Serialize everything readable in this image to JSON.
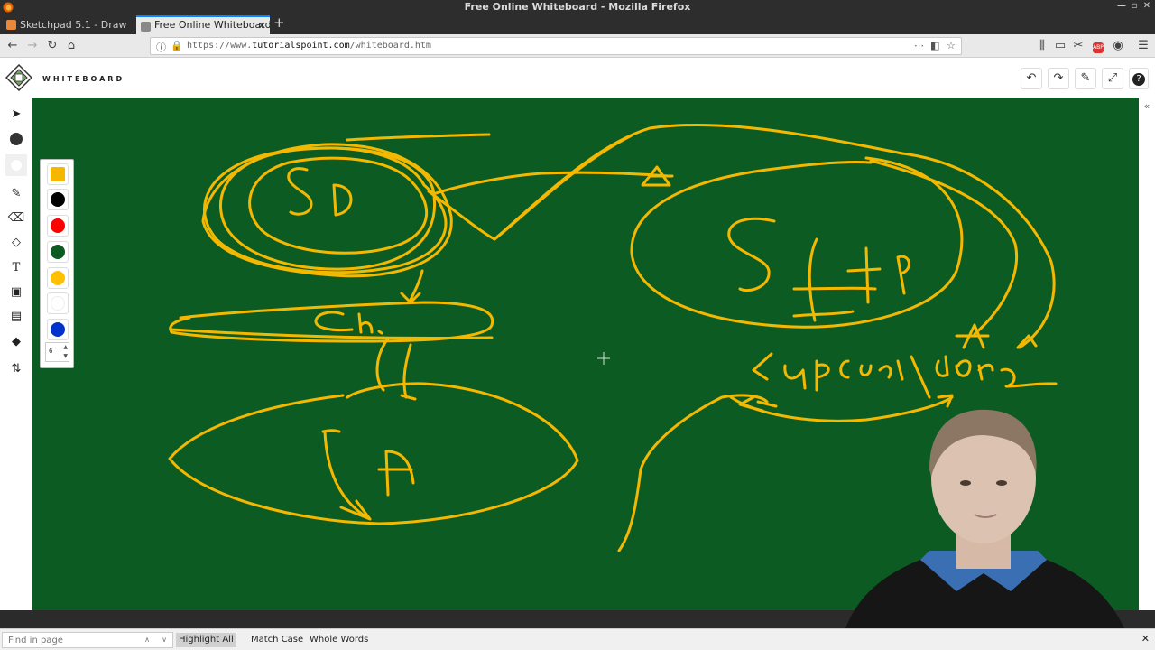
{
  "window": {
    "title": "Free Online Whiteboard - Mozilla Firefox"
  },
  "tabs": [
    {
      "label": "Sketchpad 5.1 - Draw",
      "favicon_color": "#e8883a"
    },
    {
      "label": "Free Online Whiteboard",
      "favicon_color": "#888888"
    }
  ],
  "nav": {
    "url_prefix": "https://www.",
    "url_domain": "tutorialspoint.com",
    "url_path": "/whiteboard.htm"
  },
  "app": {
    "brand": "WHITEBOARD",
    "header_buttons": [
      {
        "name": "undo-button",
        "icon": "undo-icon",
        "glyph": "↶"
      },
      {
        "name": "redo-button",
        "icon": "redo-icon",
        "glyph": "↷"
      },
      {
        "name": "clear-button",
        "icon": "broom-icon",
        "glyph": "✎"
      },
      {
        "name": "fullscreen-button",
        "icon": "expand-icon",
        "glyph": "⤢"
      },
      {
        "name": "help-button",
        "icon": "question-icon",
        "glyph": "?"
      }
    ],
    "tools": [
      {
        "name": "select-tool",
        "icon": "cursor-arrow-icon",
        "glyph": "➤"
      },
      {
        "name": "stroke-color-tool",
        "icon": "filled-circle-icon",
        "glyph": "●"
      },
      {
        "name": "fill-color-tool",
        "icon": "empty-circle-icon",
        "glyph": "○"
      },
      {
        "name": "pencil-tool",
        "icon": "pencil-icon",
        "glyph": "✎"
      },
      {
        "name": "eraser-tool",
        "icon": "eraser-icon",
        "glyph": "⌫"
      },
      {
        "name": "shapes-tool",
        "icon": "shapes-icon",
        "glyph": "◇"
      },
      {
        "name": "text-tool",
        "icon": "text-icon",
        "glyph": "T"
      },
      {
        "name": "image-tool",
        "icon": "image-icon",
        "glyph": "▣"
      },
      {
        "name": "template-tool",
        "icon": "template-icon",
        "glyph": "▤"
      },
      {
        "name": "chat-tool",
        "icon": "chat-bubble-icon",
        "glyph": "💬"
      },
      {
        "name": "import-export-tool",
        "icon": "up-down-arrows-icon",
        "glyph": "⇅"
      }
    ],
    "palette": {
      "colors": [
        "#f5b800",
        "#000000",
        "#ff0000",
        "#0c5b22",
        "#ffc000",
        "#ffffff",
        "#0033cc"
      ],
      "selected_index": 0,
      "brush_size": "6"
    },
    "board_background": "#0c5b22",
    "ink_color": "#f5b800"
  },
  "find": {
    "placeholder": "Find in page",
    "highlight_all": "Highlight All",
    "match_case": "Match Case",
    "whole_words": "Whole Words"
  }
}
